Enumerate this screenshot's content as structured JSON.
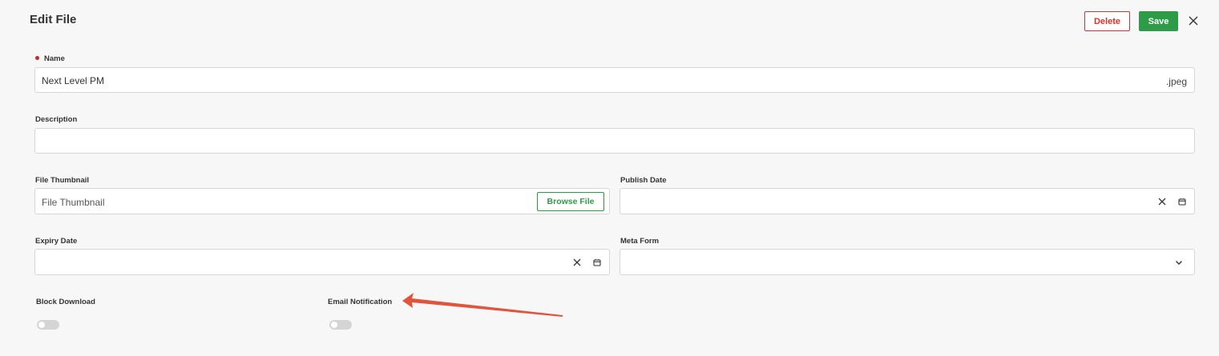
{
  "header": {
    "title": "Edit File",
    "delete_label": "Delete",
    "save_label": "Save"
  },
  "form": {
    "name": {
      "label": "Name",
      "required": true,
      "value": "Next Level PM",
      "suffix": ".jpeg"
    },
    "description": {
      "label": "Description",
      "value": ""
    },
    "file_thumbnail": {
      "label": "File Thumbnail",
      "placeholder": "File Thumbnail",
      "browse_label": "Browse File"
    },
    "publish_date": {
      "label": "Publish Date",
      "value": ""
    },
    "expiry_date": {
      "label": "Expiry Date",
      "value": ""
    },
    "meta_form": {
      "label": "Meta Form",
      "value": ""
    },
    "block_download": {
      "label": "Block Download",
      "enabled": false
    },
    "email_notification": {
      "label": "Email Notification",
      "enabled": false
    }
  },
  "icons": {
    "close": "close-icon",
    "clear": "clear-icon",
    "calendar": "calendar-icon",
    "chevron": "chevron-down-icon"
  },
  "colors": {
    "danger": "#d9312b",
    "primary": "#2e9b48",
    "annotation_arrow": "#e2533b"
  }
}
